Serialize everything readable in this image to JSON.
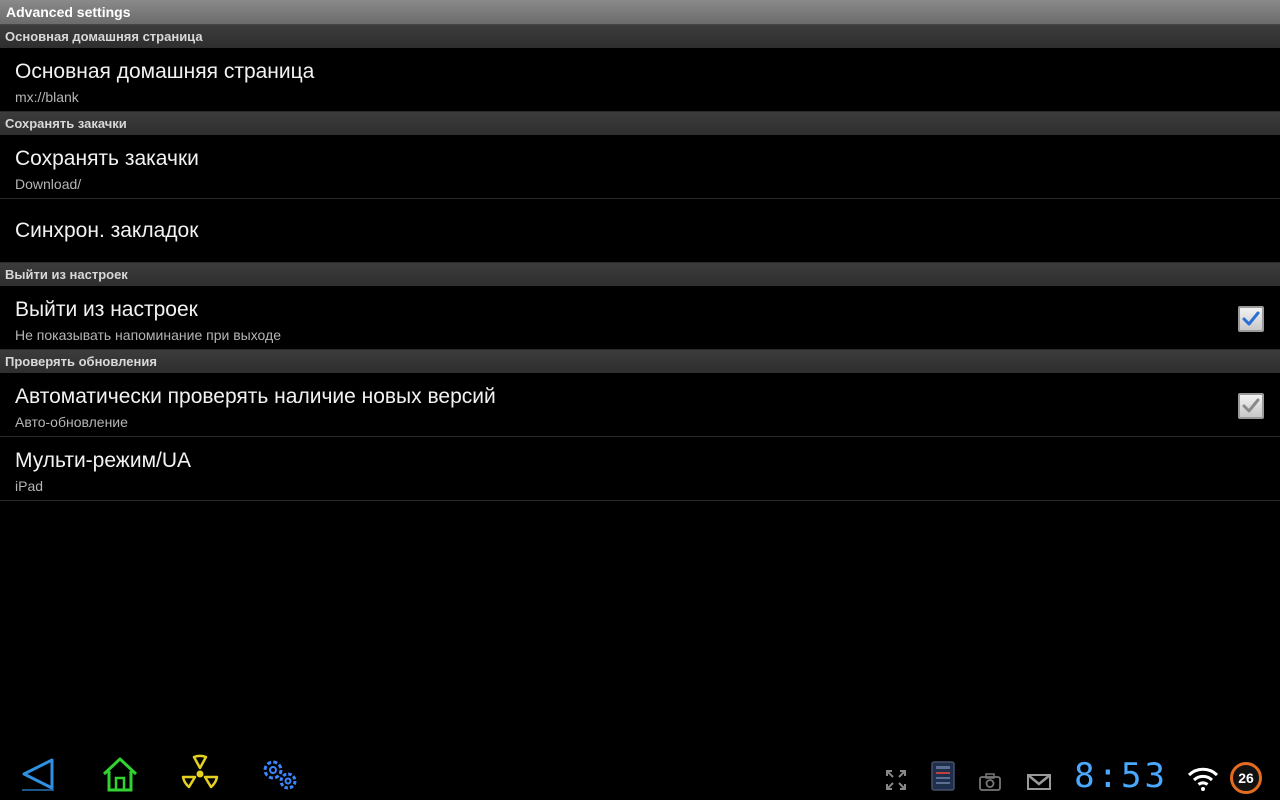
{
  "window": {
    "title": "Advanced settings"
  },
  "sections": [
    {
      "header": "Основная домашняя страница",
      "items": [
        {
          "title": "Основная домашняя страница",
          "summary": "mx://blank"
        }
      ]
    },
    {
      "header": "Сохранять закачки",
      "items": [
        {
          "title": "Сохранять закачки",
          "summary": "Download/"
        },
        {
          "title": "Синхрон. закладок"
        }
      ]
    },
    {
      "header": "Выйти из настроек",
      "items": [
        {
          "title": "Выйти из настроек",
          "summary": "Не показывать напоминание при выходе",
          "checked": true
        }
      ]
    },
    {
      "header": "Проверять обновления",
      "items": [
        {
          "title": "Автоматически проверять наличие новых версий",
          "summary": "Авто-обновление",
          "checked": true,
          "disabled": true
        },
        {
          "title": "Мульти-режим/UA",
          "summary": "iPad"
        }
      ]
    }
  ],
  "navbar": {
    "buttons": [
      "back-icon",
      "home-icon",
      "radiation-icon",
      "gears-icon"
    ],
    "status_icons": [
      "fullscreen-icon",
      "sd-card-icon",
      "camera-icon",
      "gmail-icon",
      "wifi-icon"
    ],
    "clock": "8:53",
    "battery": "26"
  },
  "colors": {
    "clock": "#4aa9ff",
    "back": "#2f8fe0",
    "home": "#32d232",
    "radiation": "#e6d020",
    "gears": "#3a86ff",
    "battery_ring": "#e46b1f"
  }
}
